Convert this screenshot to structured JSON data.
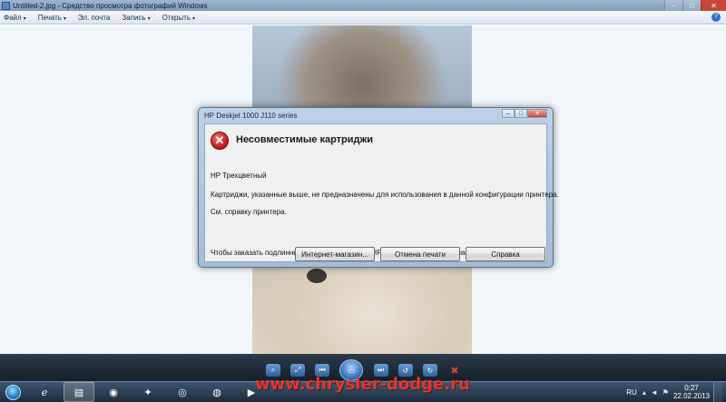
{
  "window": {
    "title": "Untitled-2.jpg - Средство просмотра фотографий Windows",
    "minimize": "–",
    "maximize": "□",
    "close": "✕"
  },
  "menu": {
    "items": [
      {
        "label": "Файл",
        "arrow": "▾"
      },
      {
        "label": "Печать",
        "arrow": "▾"
      },
      {
        "label": "Эл. почта",
        "arrow": ""
      },
      {
        "label": "Запись",
        "arrow": "▾"
      },
      {
        "label": "Открыть",
        "arrow": "▾"
      }
    ],
    "help_glyph": "?"
  },
  "dialog": {
    "title": "HP Deskjet 1000 J110 series",
    "heading": "Несовместимые картриджи",
    "lines": [
      "HP Трехцветный",
      "Картриджи, указанные выше, не предназначены для использования в данной конфигурации принтера.",
      "См. справку принтера.",
      "Чтобы заказать подлинный запасной картридж HP, щелкните \"Интернет-магазин\"."
    ],
    "buttons": {
      "store": "Интернет-магазин...",
      "cancel": "Отмена печати",
      "help": "Справка"
    }
  },
  "taskbar": {
    "language": "RU",
    "time": "0:27",
    "date": "22.02.2013"
  },
  "watermark": "www.chrysler-dodge.ru",
  "colors": {
    "accent": "#2f5f9c",
    "error": "#c21818",
    "watermark": "#e5352a"
  }
}
